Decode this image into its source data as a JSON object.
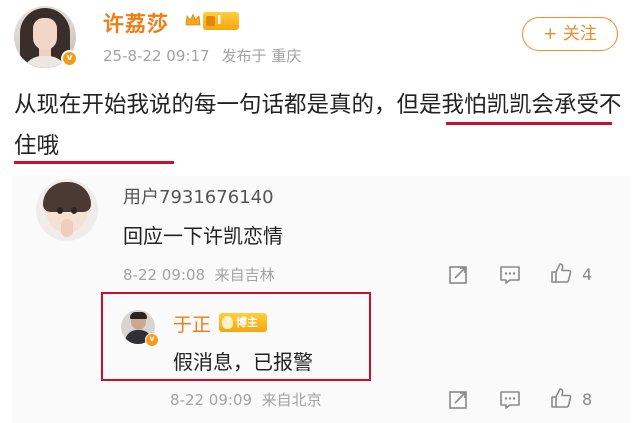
{
  "post": {
    "username": "许荔莎",
    "level": "I",
    "date": "25-8-22 09:17",
    "location": "发布于 重庆",
    "follow_label": "+ 关注",
    "body_prefix": "从现在开始我说的每一句话都是真的，",
    "body_highlight": "但是我怕凯凯会承受不住哦",
    "verified_mark": "v"
  },
  "comment": {
    "username": "用户7931676140",
    "text": "回应一下许凯恋情",
    "date": "8-22 09:08",
    "location": "来自吉林",
    "like_count": "4"
  },
  "reply": {
    "username": "于正",
    "badge_label": "博主",
    "text": "假消息，已报警",
    "date": "8-22 09:09",
    "location": "来自北京",
    "like_count": "8",
    "verified_mark": "v"
  },
  "colors": {
    "username_orange": "#f27b12",
    "highlight_red": "#c8102e",
    "meta_gray": "#a3a3a3"
  },
  "icons": [
    "crown-icon",
    "share-icon",
    "comment-icon",
    "like-icon",
    "verified-icon"
  ]
}
